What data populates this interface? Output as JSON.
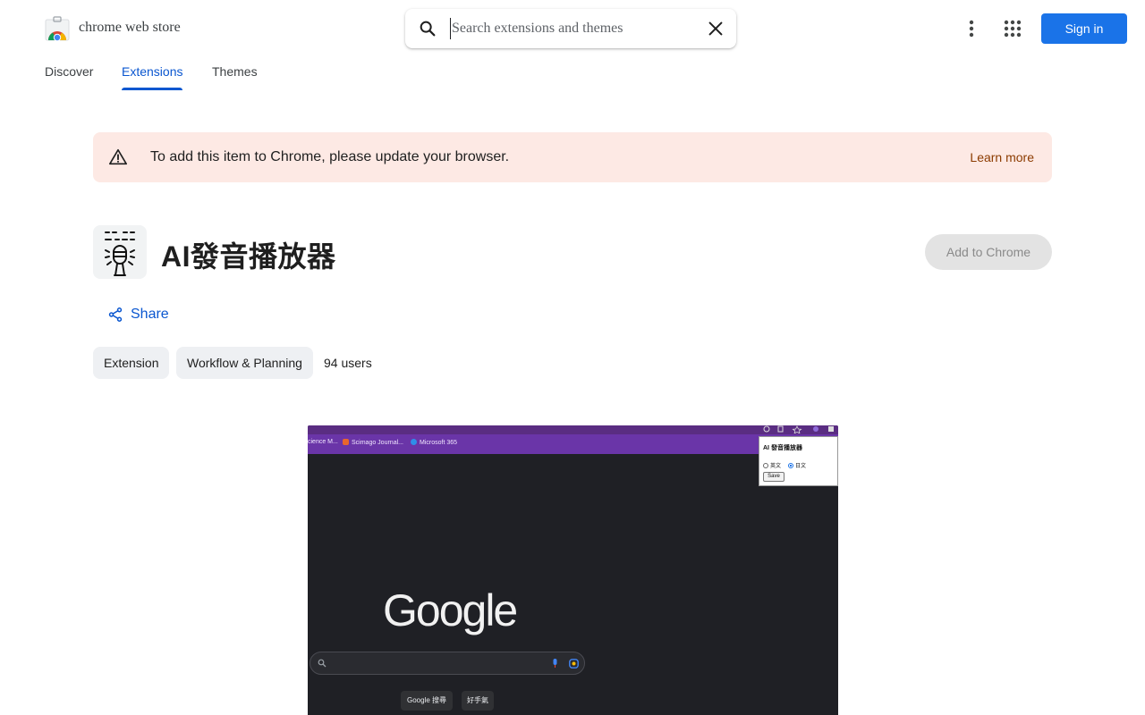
{
  "header": {
    "brand": "chrome web store",
    "search_placeholder": "Search extensions and themes",
    "sign_in": "Sign in"
  },
  "nav": {
    "tabs": [
      {
        "label": "Discover",
        "active": false
      },
      {
        "label": "Extensions",
        "active": true
      },
      {
        "label": "Themes",
        "active": false
      }
    ]
  },
  "banner": {
    "message": "To add this item to Chrome, please update your browser.",
    "link": "Learn more"
  },
  "item": {
    "title": "AI發音播放器",
    "add_button": "Add to Chrome",
    "share": "Share",
    "chips": [
      "Extension",
      "Workflow & Planning"
    ],
    "users": "94 users"
  },
  "preview": {
    "bookmarks": [
      "cience M...",
      "Scimago Journal...",
      "Microsoft 365"
    ],
    "popup": {
      "title": "AI 發音播放器",
      "option_1": "英文",
      "option_2": "日文",
      "selected": "日文",
      "save": "Save"
    },
    "google_logo": "Google",
    "buttons": [
      "Google 搜尋",
      "好手氣"
    ]
  },
  "colors": {
    "accent": "#1a73e8",
    "active_tab": "#0b57d0",
    "banner_bg": "#fde9e4",
    "banner_link": "#8c3b00",
    "preview_bg": "#1f2025",
    "preview_bar": "#6a35a8"
  }
}
